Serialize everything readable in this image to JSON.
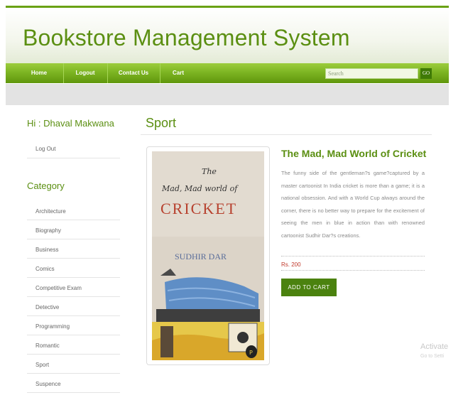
{
  "site": {
    "title": "Bookstore Management System"
  },
  "nav": {
    "items": [
      "Home",
      "Logout",
      "Contact Us",
      "Cart"
    ],
    "search_placeholder": "Search",
    "go_label": "GO"
  },
  "sidebar": {
    "greeting": "Hi : Dhaval Makwana",
    "logout_label": "Log Out",
    "category_title": "Category",
    "categories": [
      "Architecture",
      "Biography",
      "Business",
      "Comics",
      "Competitive Exam",
      "Detective",
      "Programming",
      "Romantic",
      "Sport",
      "Suspence"
    ]
  },
  "main": {
    "section_title": "Sport",
    "book": {
      "title": "The Mad, Mad World of Cricket",
      "description": "The funny side of the gentleman?s game?captured by a master cartoonist In India cricket is more than a game; it is a national obsession. And with a World Cup always around the corner, there is no better way to prepare for the excitement of seeing the men in blue in action than with renowned cartoonist Sudhir Dar?s creations.",
      "price": "Rs. 200",
      "add_to_cart_label": "ADD TO CART",
      "cover": {
        "title_line1": "The",
        "title_line2": "Mad, Mad world of",
        "title_big": "CRICKET",
        "author": "SUDHIR DAR"
      }
    }
  },
  "watermark": {
    "line1": "Activate",
    "line2": "Go to Setti"
  }
}
